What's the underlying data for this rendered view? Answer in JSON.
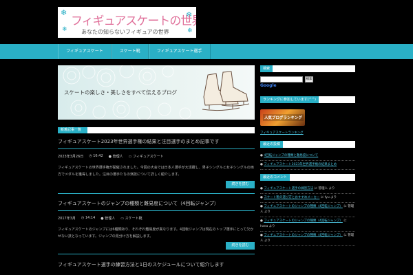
{
  "site": {
    "title": "フィギュアスケートの世界",
    "subtitle": "あなたの知らないフィギュアの世界"
  },
  "nav": {
    "items": [
      {
        "label": "フィギュアスケート"
      },
      {
        "label": "スケート靴"
      },
      {
        "label": "フィギュアスケート選手"
      }
    ]
  },
  "hero": {
    "tagline": "スケートの楽しさ・美しさをすべて伝えるブログ"
  },
  "main": {
    "section_label": "新着記事一覧",
    "posts": [
      {
        "title": "フィギュアスケート2023年世界選手権の結果と注目選手のまとめ記事です",
        "date": "2023年3月26日",
        "time": "16:42",
        "author": "管理人",
        "category": "フィギュアスケート",
        "excerpt": "フィギュアスケートの世界選手権が開催されました。今回の大会では日本人選手が大活躍し、男子シングルと女子シングルの両方でメダルを獲得しました。注目の選手たちの演技について詳しく紹介します。",
        "more": "続きを読む"
      },
      {
        "title": "フィギュアスケートのジャンプの種類と難易度について（4回転ジャンプ）",
        "date": "2017年3月",
        "time": "14:14",
        "author": "管理人",
        "category": "スケート靴",
        "excerpt": "フィギュアスケートのジャンプには6種類あり、それぞれ難易度が異なります。4回転ジャンプは現在のトップ選手にとって欠かせない技となっています。ジャンプの見分け方を解説します。",
        "more": "続きを読む"
      },
      {
        "title": "フィギュアスケート選手の練習方法と1日のスケジュールについて紹介します"
      }
    ]
  },
  "sidebar": {
    "search_title": "検索",
    "search_button": "検索",
    "google": "Google",
    "ranking_title": "ランキングに参加しています(^^)",
    "ranking_banner": "人気ブログランキング",
    "ranking_link": "フィギュアスケートランキング",
    "recent_title": "最近の投稿",
    "recent": [
      "4回転ジャンプの種類と難易度について",
      "フィギュアスケート2023年世界選手権の結果まとめ"
    ],
    "comments_title": "最近のコメント",
    "comments": [
      {
        "link": "フィギュアスケート選手の練習方法",
        "text": "に 管理人 より"
      },
      {
        "link": "スケート靴の選び方とおすすめメーカー",
        "text": "に fyu より"
      },
      {
        "link": "フィギュアスケートのジャンプの種類（4回転ジャンプ）",
        "text": "に 管理人 より"
      },
      {
        "link": "フィギュアスケートのジャンプの種類（4回転ジャンプ）",
        "text": "に hana より"
      },
      {
        "link": "フィギュアスケートのジャンプの種類（4回転ジャンプ）",
        "text": "に 管理人 より"
      }
    ]
  },
  "colors": {
    "accent": "#2ab0c6",
    "background": "#000000",
    "title_pink": "#e0709a"
  }
}
